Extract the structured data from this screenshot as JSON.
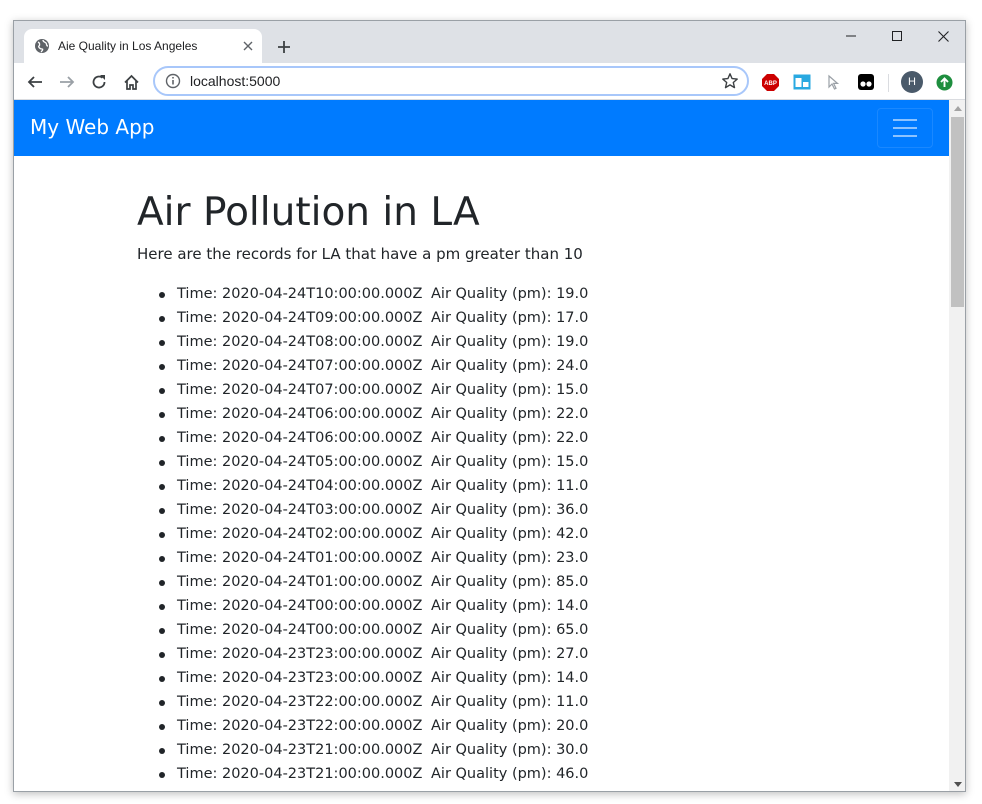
{
  "browser": {
    "tab_title": "Aie Quality in Los Angeles",
    "url": "localhost:5000",
    "profile_initial": "H",
    "icons": {
      "favicon": "globe-icon",
      "close": "close-icon",
      "new_tab": "plus-icon",
      "back": "arrow-left-icon",
      "forward": "arrow-right-icon",
      "reload": "reload-icon",
      "home": "home-icon",
      "site_info": "info-icon",
      "bookmark": "star-icon",
      "extensions": [
        "adblock-icon",
        "tab-extension-icon",
        "cursor-extension-icon",
        "tampermonkey-icon"
      ],
      "update": "update-arrow-icon"
    },
    "colors": {
      "tab_strip": "#dee1e6",
      "adblock": "#c00",
      "update": "#1e8e3e",
      "profile": "#4a5a6a"
    }
  },
  "navbar": {
    "brand": "My Web App",
    "color": "#007bff"
  },
  "page": {
    "title": "Air Pollution in LA",
    "description": "Here are the records for LA that have a pm greater than 10",
    "records": [
      {
        "time": "Time: 2020-04-24T10:00:00.000Z",
        "quality": "Air Quality (pm): 19.0"
      },
      {
        "time": "Time: 2020-04-24T09:00:00.000Z",
        "quality": "Air Quality (pm): 17.0"
      },
      {
        "time": "Time: 2020-04-24T08:00:00.000Z",
        "quality": "Air Quality (pm): 19.0"
      },
      {
        "time": "Time: 2020-04-24T07:00:00.000Z",
        "quality": "Air Quality (pm): 24.0"
      },
      {
        "time": "Time: 2020-04-24T07:00:00.000Z",
        "quality": "Air Quality (pm): 15.0"
      },
      {
        "time": "Time: 2020-04-24T06:00:00.000Z",
        "quality": "Air Quality (pm): 22.0"
      },
      {
        "time": "Time: 2020-04-24T06:00:00.000Z",
        "quality": "Air Quality (pm): 22.0"
      },
      {
        "time": "Time: 2020-04-24T05:00:00.000Z",
        "quality": "Air Quality (pm): 15.0"
      },
      {
        "time": "Time: 2020-04-24T04:00:00.000Z",
        "quality": "Air Quality (pm): 11.0"
      },
      {
        "time": "Time: 2020-04-24T03:00:00.000Z",
        "quality": "Air Quality (pm): 36.0"
      },
      {
        "time": "Time: 2020-04-24T02:00:00.000Z",
        "quality": "Air Quality (pm): 42.0"
      },
      {
        "time": "Time: 2020-04-24T01:00:00.000Z",
        "quality": "Air Quality (pm): 23.0"
      },
      {
        "time": "Time: 2020-04-24T01:00:00.000Z",
        "quality": "Air Quality (pm): 85.0"
      },
      {
        "time": "Time: 2020-04-24T00:00:00.000Z",
        "quality": "Air Quality (pm): 14.0"
      },
      {
        "time": "Time: 2020-04-24T00:00:00.000Z",
        "quality": "Air Quality (pm): 65.0"
      },
      {
        "time": "Time: 2020-04-23T23:00:00.000Z",
        "quality": "Air Quality (pm): 27.0"
      },
      {
        "time": "Time: 2020-04-23T23:00:00.000Z",
        "quality": "Air Quality (pm): 14.0"
      },
      {
        "time": "Time: 2020-04-23T22:00:00.000Z",
        "quality": "Air Quality (pm): 11.0"
      },
      {
        "time": "Time: 2020-04-23T22:00:00.000Z",
        "quality": "Air Quality (pm): 20.0"
      },
      {
        "time": "Time: 2020-04-23T21:00:00.000Z",
        "quality": "Air Quality (pm): 30.0"
      },
      {
        "time": "Time: 2020-04-23T21:00:00.000Z",
        "quality": "Air Quality (pm): 46.0"
      }
    ]
  }
}
